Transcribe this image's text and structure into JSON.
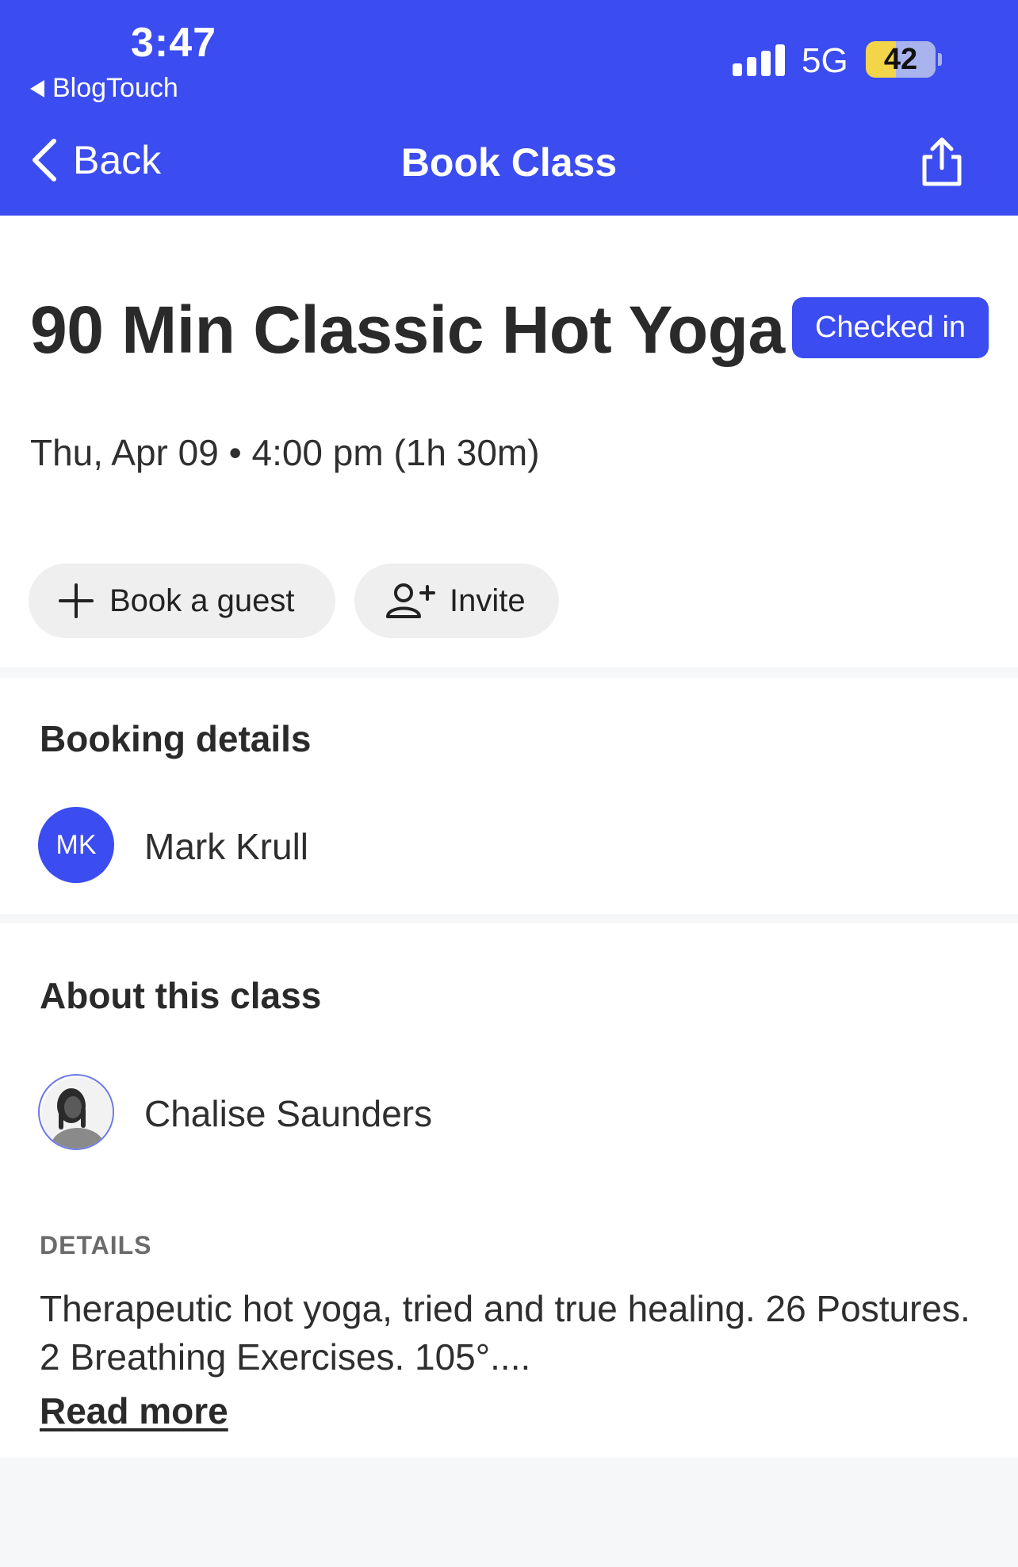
{
  "status_bar": {
    "time": "3:47",
    "back_app": "BlogTouch",
    "network": "5G",
    "battery": "42"
  },
  "nav": {
    "back_label": "Back",
    "title": "Book Class",
    "share_icon": "share-icon"
  },
  "class": {
    "title": "90 Min Classic Hot Yoga",
    "status_badge": "Checked in",
    "datetime": "Thu, Apr 09 • 4:00 pm (1h 30m)"
  },
  "actions": {
    "book_guest": "Book a guest",
    "invite": "Invite"
  },
  "booking": {
    "section_title": "Booking details",
    "initials": "MK",
    "name": "Mark Krull"
  },
  "about": {
    "section_title": "About this class",
    "instructor": "Chalise Saunders",
    "details_label": "DETAILS",
    "details_text": "Therapeutic hot yoga, tried and true healing. 26 Postures. 2 Breathing Exercises. 105°....",
    "read_more": "Read more"
  },
  "colors": {
    "brand": "#3b4cf0",
    "battery": "#f3d549",
    "pill_bg": "#efefef"
  }
}
